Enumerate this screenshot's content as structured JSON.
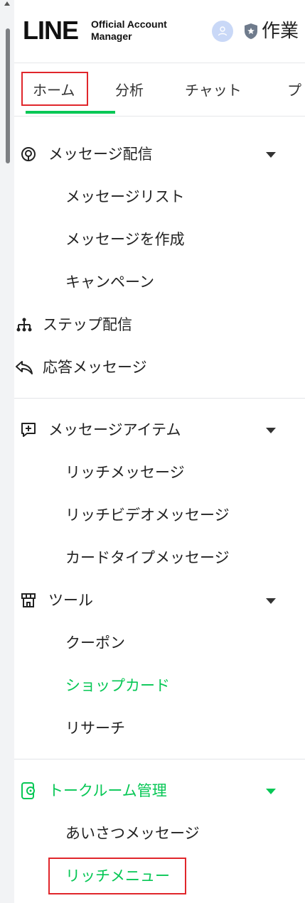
{
  "header": {
    "logo_text": "LINE",
    "logo_sub_line1": "Official Account",
    "logo_sub_line2": "Manager",
    "account_name": "作業"
  },
  "tabs": [
    {
      "label": "ホーム",
      "active": true
    },
    {
      "label": "分析"
    },
    {
      "label": "チャット"
    },
    {
      "label": "プ"
    }
  ],
  "sidebar": {
    "sections": [
      {
        "label": "メッセージ配信",
        "icon": "broadcast-icon",
        "expandable": true,
        "items": [
          "メッセージリスト",
          "メッセージを作成",
          "キャンペーン"
        ]
      },
      {
        "label": "ステップ配信",
        "icon": "step-tree-icon"
      },
      {
        "label": "応答メッセージ",
        "icon": "reply-arrow-icon"
      },
      {
        "label": "メッセージアイテム",
        "icon": "add-message-icon",
        "expandable": true,
        "items": [
          "リッチメッセージ",
          "リッチビデオメッセージ",
          "カードタイプメッセージ"
        ]
      },
      {
        "label": "ツール",
        "icon": "shop-tool-icon",
        "expandable": true,
        "items": [
          "クーポン",
          "ショップカード",
          "リサーチ"
        ]
      },
      {
        "label": "トークルーム管理",
        "icon": "talkroom-icon",
        "expandable": true,
        "items": [
          "あいさつメッセージ",
          "リッチメニュー"
        ]
      }
    ]
  },
  "colors": {
    "accent": "#06c755",
    "highlight_box": "#e0262b"
  }
}
